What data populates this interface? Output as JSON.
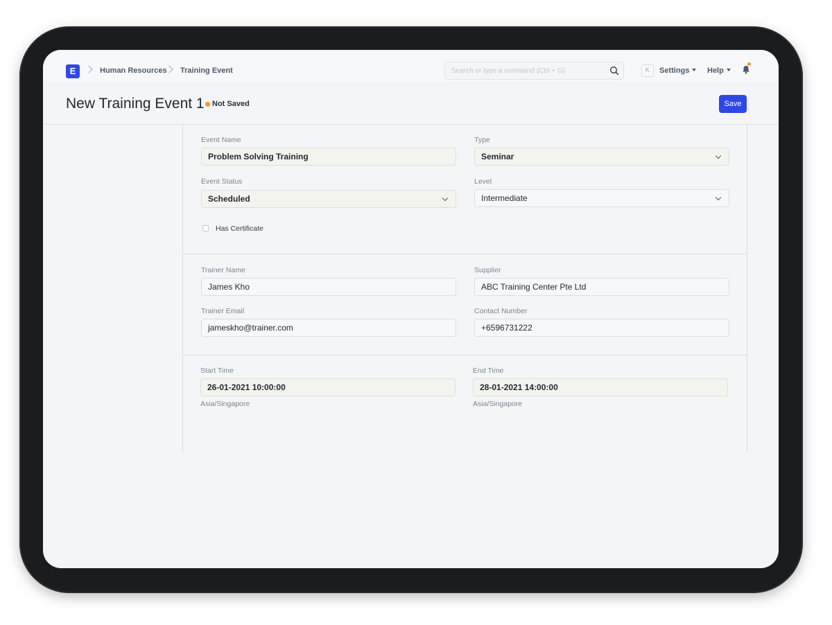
{
  "breadcrumb": {
    "logo_letter": "E",
    "items": [
      "Human Resources",
      "Training Event"
    ]
  },
  "navbar": {
    "search_placeholder": "Search or type a command (Ctrl + G)",
    "keyboard_key": "K",
    "settings_label": "Settings",
    "help_label": "Help",
    "notification_color": "#f39a20"
  },
  "header": {
    "title": "New Training Event 1",
    "status": "Not Saved",
    "status_color": "#f39a20",
    "save_label": "Save",
    "accent_color": "#2e48e8"
  },
  "form": {
    "event_name": {
      "label": "Event Name",
      "value": "Problem Solving Training"
    },
    "type": {
      "label": "Type",
      "value": "Seminar"
    },
    "event_status": {
      "label": "Event Status",
      "value": "Scheduled"
    },
    "level": {
      "label": "Level",
      "value": "Intermediate"
    },
    "has_certificate": {
      "label": "Has Certificate",
      "checked": false
    },
    "trainer_name": {
      "label": "Trainer Name",
      "value": "James Kho"
    },
    "supplier": {
      "label": "Supplier",
      "value": "ABC Training Center Pte Ltd"
    },
    "trainer_email": {
      "label": "Trainer Email",
      "value": "jameskho@trainer.com"
    },
    "contact_number": {
      "label": "Contact Number",
      "value": "+6596731222"
    },
    "start_time": {
      "label": "Start Time",
      "value": "26-01-2021 10:00:00",
      "timezone": "Asia/Singapore"
    },
    "end_time": {
      "label": "End Time",
      "value": "28-01-2021 14:00:00",
      "timezone": "Asia/Singapore"
    }
  }
}
